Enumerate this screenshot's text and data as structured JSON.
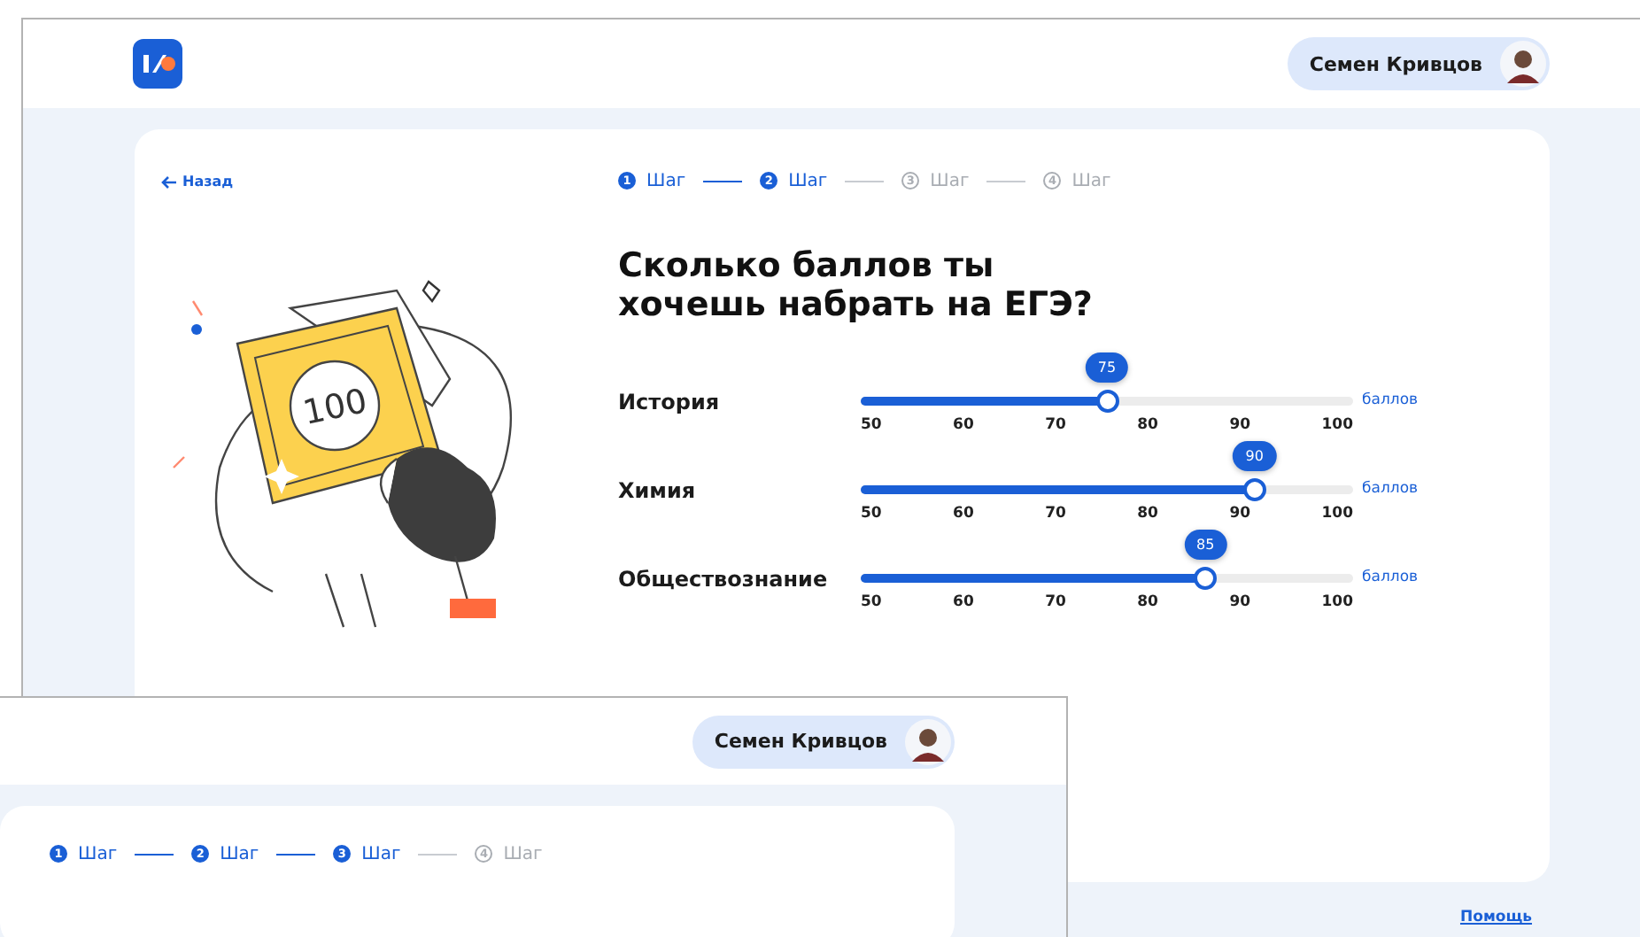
{
  "back_window": {
    "user": {
      "name": "Семен Кривцов"
    },
    "back_link": "Назад",
    "steps": [
      {
        "number": "1",
        "label": "Шаг",
        "active": true
      },
      {
        "number": "2",
        "label": "Шаг",
        "active": true
      },
      {
        "number": "3",
        "label": "Шаг",
        "active": false
      },
      {
        "number": "4",
        "label": "Шаг",
        "active": false
      }
    ],
    "illustration_badge": "100",
    "heading": "Сколько баллов ты хочешь набрать на ЕГЭ?",
    "subjects": [
      {
        "name": "История",
        "value": "75",
        "level": 0.5,
        "unit": "баллов",
        "ticks": [
          "50",
          "60",
          "70",
          "80",
          "90",
          "100"
        ]
      },
      {
        "name": "Химия",
        "value": "90",
        "level": 0.8,
        "unit": "баллов",
        "ticks": [
          "50",
          "60",
          "70",
          "80",
          "90",
          "100"
        ]
      },
      {
        "name": "Обществознание",
        "value": "85",
        "level": 0.7,
        "unit": "баллов",
        "ticks": [
          "50",
          "60",
          "70",
          "80",
          "90",
          "100"
        ]
      }
    ],
    "help_link": "Помощь"
  },
  "front_window": {
    "user": {
      "name": "Семен Кривцов"
    },
    "steps": [
      {
        "number": "1",
        "label": "Шаг",
        "active": true
      },
      {
        "number": "2",
        "label": "Шаг",
        "active": true
      },
      {
        "number": "3",
        "label": "Шаг",
        "active": true
      },
      {
        "number": "4",
        "label": "Шаг",
        "active": false
      }
    ]
  }
}
